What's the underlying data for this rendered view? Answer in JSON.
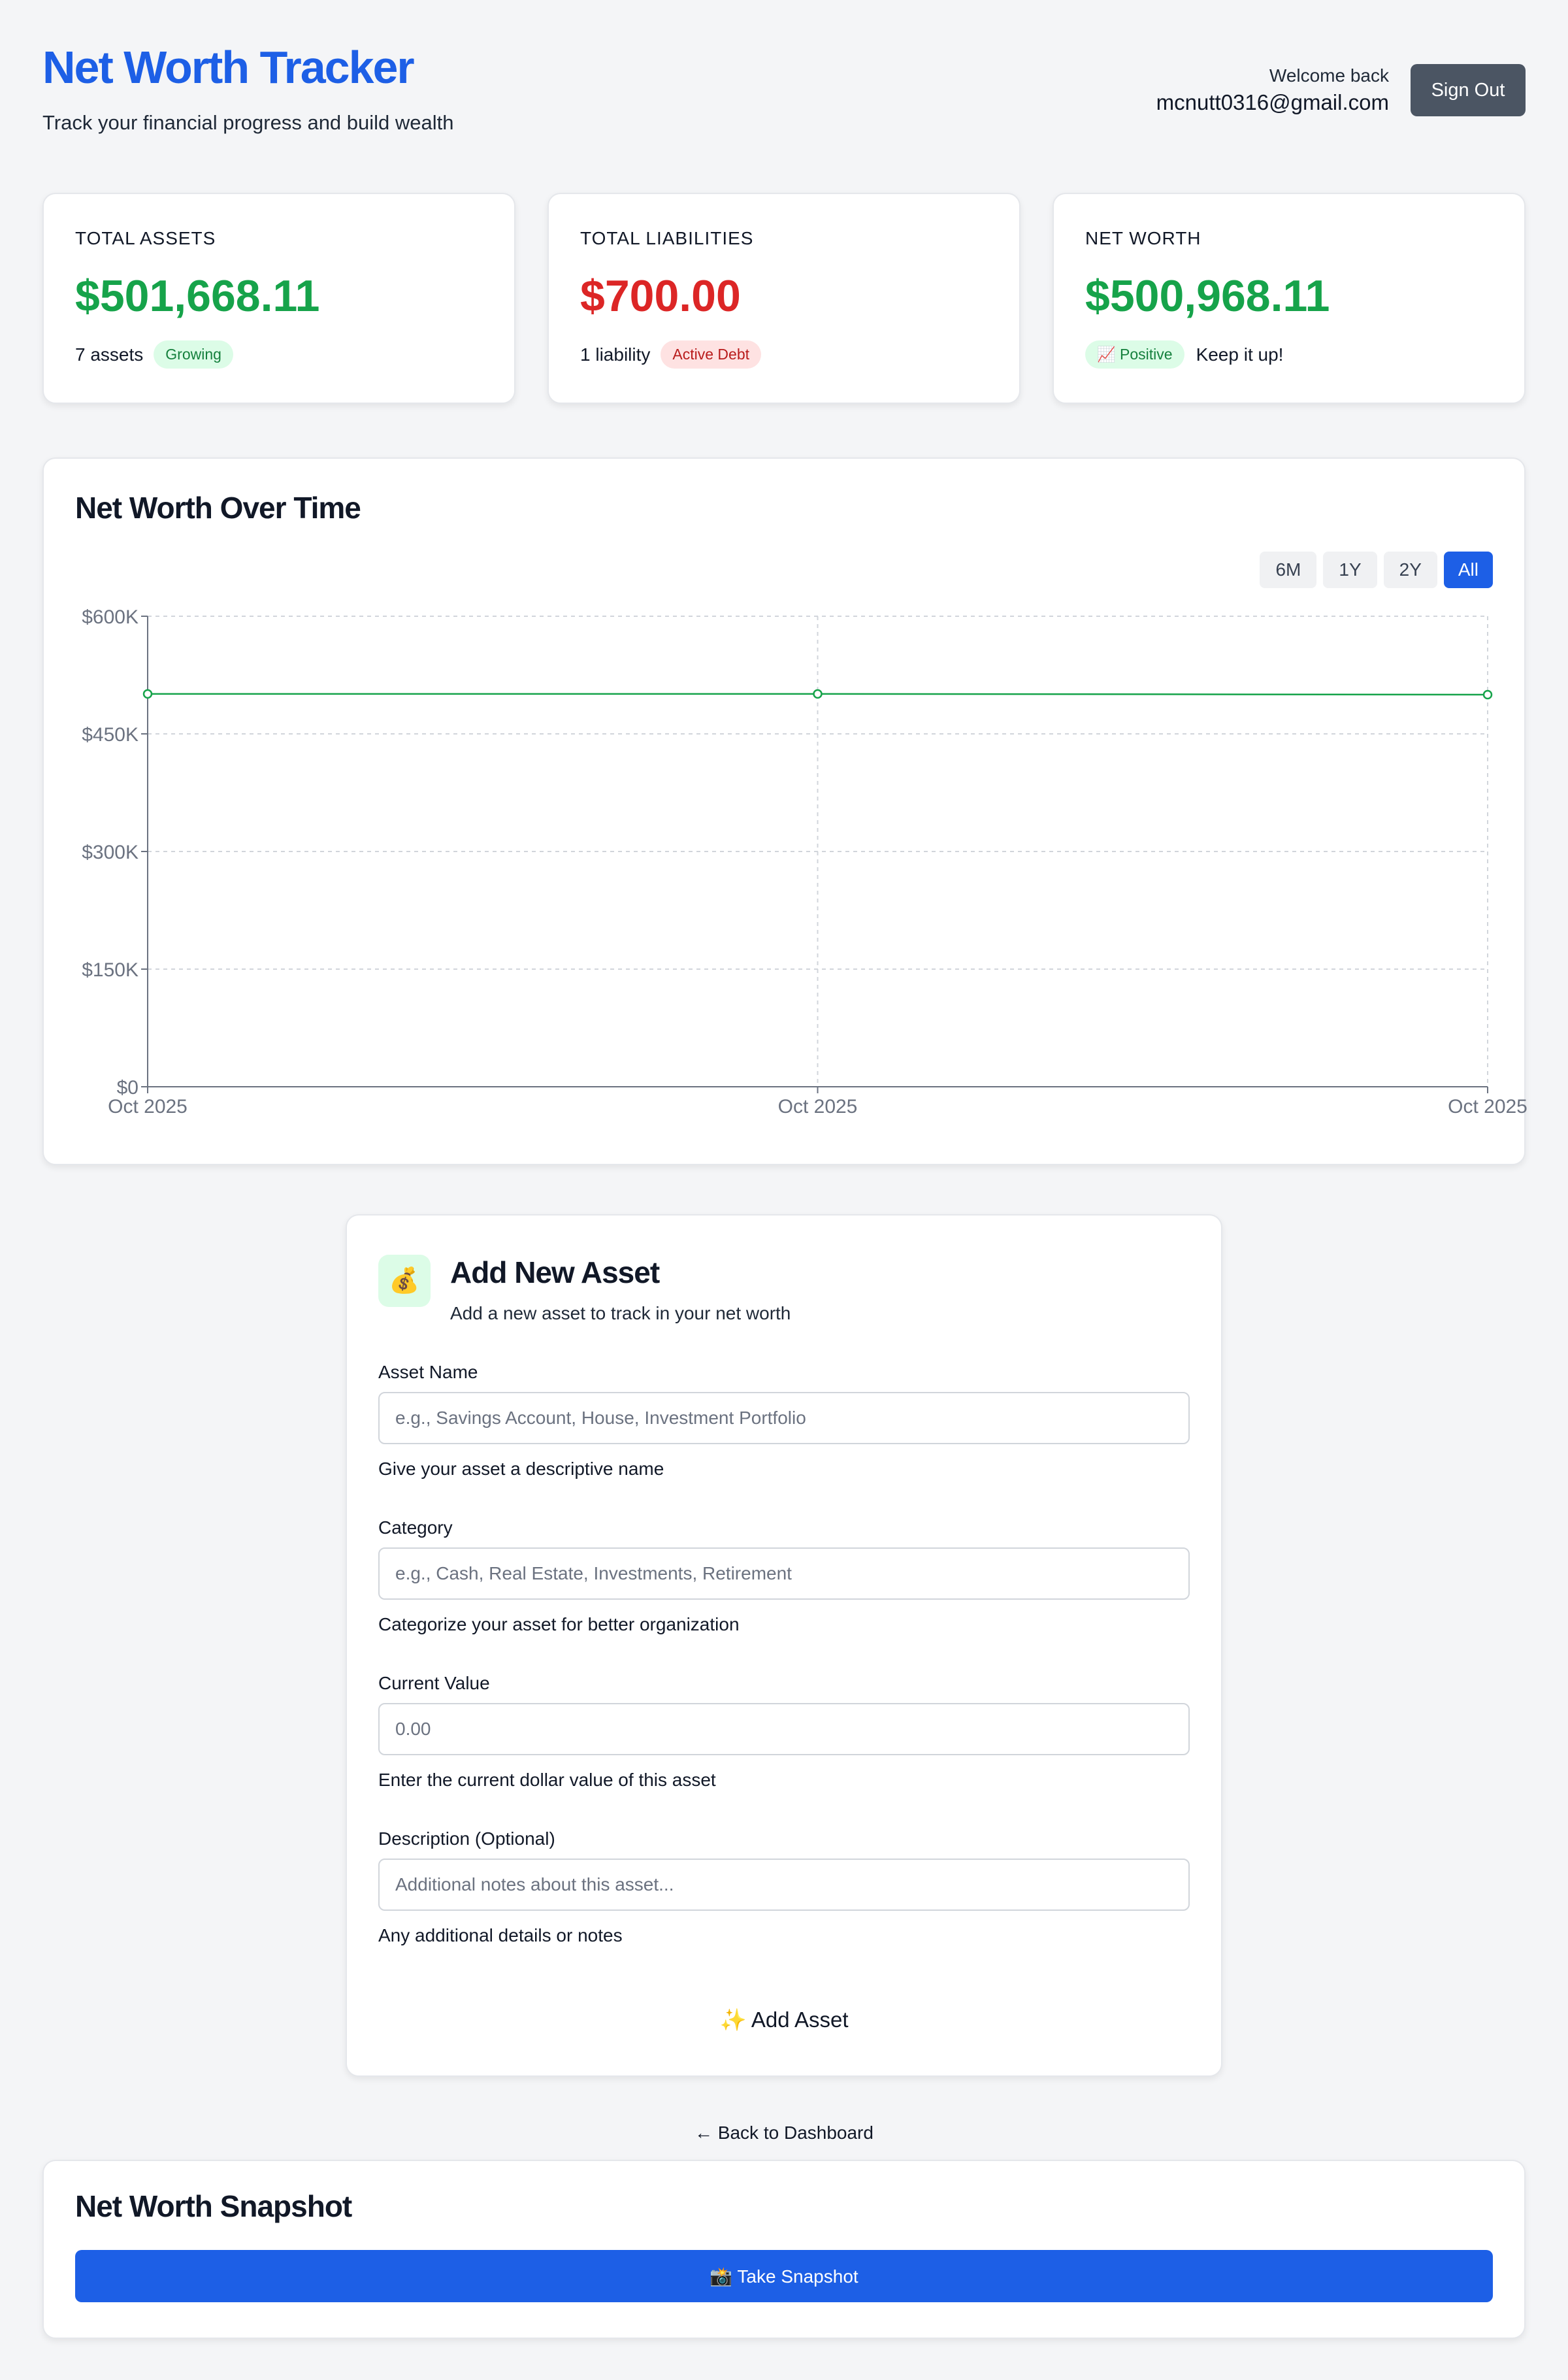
{
  "header": {
    "title": "Net Worth Tracker",
    "subtitle": "Track your financial progress and build wealth",
    "welcome": "Welcome back",
    "email": "mcnutt0316@gmail.com",
    "sign_out": "Sign Out"
  },
  "stats": {
    "assets": {
      "label": "TOTAL ASSETS",
      "value": "$501,668.11",
      "count": "7 assets",
      "badge": "Growing"
    },
    "liabilities": {
      "label": "TOTAL LIABILITIES",
      "value": "$700.00",
      "count": "1 liability",
      "badge": "Active Debt"
    },
    "net": {
      "label": "NET WORTH",
      "value": "$500,968.11",
      "badge": "📈 Positive",
      "note": "Keep it up!"
    }
  },
  "chart": {
    "title": "Net Worth Over Time",
    "ranges": [
      "6M",
      "1Y",
      "2Y",
      "All"
    ],
    "active_range": "All"
  },
  "chart_data": {
    "type": "line",
    "title": "Net Worth Over Time",
    "x": [
      "Oct 2025",
      "Oct 2025",
      "Oct 2025"
    ],
    "y_tick_labels": [
      "$0",
      "$150K",
      "$300K",
      "$450K",
      "$600K"
    ],
    "ylim": [
      0,
      600000
    ],
    "grid": true,
    "series": [
      {
        "values": [
          500968,
          500968,
          500000
        ],
        "color": "#16a34a"
      }
    ]
  },
  "form": {
    "icon": "💰",
    "title": "Add New Asset",
    "subtitle": "Add a new asset to track in your net worth",
    "fields": [
      {
        "label": "Asset Name",
        "placeholder": "e.g., Savings Account, House, Investment Portfolio",
        "hint": "Give your asset a descriptive name"
      },
      {
        "label": "Category",
        "placeholder": "e.g., Cash, Real Estate, Investments, Retirement",
        "hint": "Categorize your asset for better organization"
      },
      {
        "label": "Current Value",
        "placeholder": "0.00",
        "hint": "Enter the current dollar value of this asset"
      },
      {
        "label": "Description (Optional)",
        "placeholder": "Additional notes about this asset...",
        "hint": "Any additional details or notes"
      }
    ],
    "submit": "✨ Add Asset"
  },
  "back_link": "←  Back to Dashboard",
  "snapshot": {
    "title": "Net Worth Snapshot",
    "button": "📸 Take Snapshot"
  }
}
